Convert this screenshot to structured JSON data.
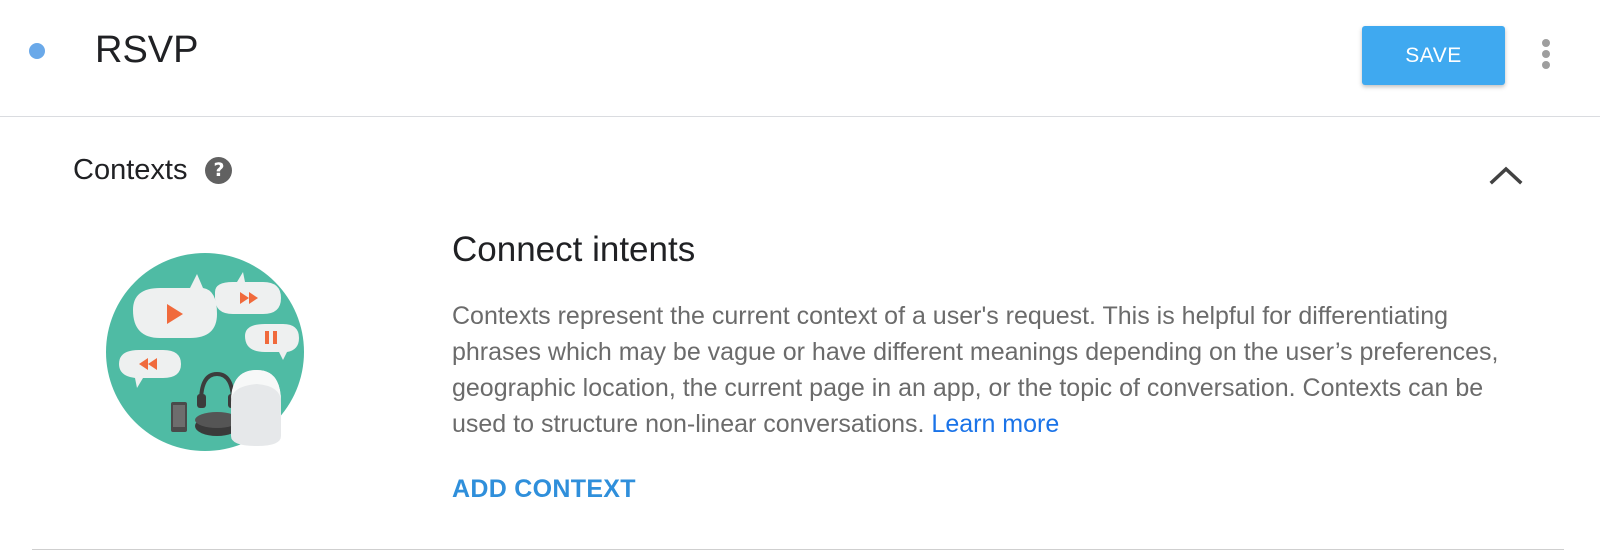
{
  "header": {
    "title": "RSVP",
    "save_label": "SAVE",
    "status_dot_color": "#6aa9e9",
    "save_color": "#3fa9f0"
  },
  "section": {
    "title": "Contexts",
    "help_icon": "help-circle-icon",
    "collapse_icon": "chevron-up-icon"
  },
  "content": {
    "heading": "Connect intents",
    "body": "Contexts represent the current context of a user's request. This is helpful for differentiating phrases which may be vague or have different meanings depending on the user’s preferences, geographic location, the current page in an app, or the topic of conversation. Contexts can be used to structure non-linear conversations. ",
    "learn_more": "Learn more",
    "add_context_label": "ADD CONTEXT",
    "link_color": "#1a73e8"
  }
}
